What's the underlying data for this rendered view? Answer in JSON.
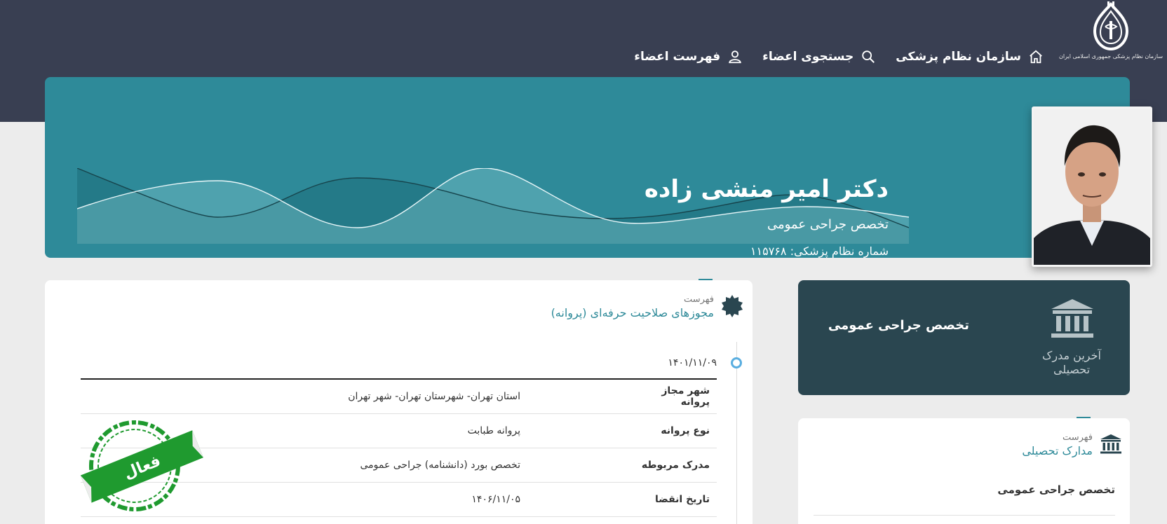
{
  "header": {
    "logo_caption": "سازمان نظام پزشکی جمهوری اسلامی ایران",
    "nav": [
      {
        "label": "سازمان نظام پزشکی",
        "icon": "home-icon"
      },
      {
        "label": "جستجوی اعضاء",
        "icon": "search-icon"
      },
      {
        "label": "فهرست اعضاء",
        "icon": "user-icon"
      }
    ]
  },
  "profile": {
    "name": "دکتر امیر منشی زاده",
    "specialty": "تخصص جراحی عمومی",
    "medical_number": "شماره نظام پزشکی: ۱۱۵۷۶۸"
  },
  "licenses": {
    "small": "فهرست",
    "title": "مجوزهای صلاحیت حرفه‌ای (پروانه)",
    "date": "۱۴۰۱/۱۱/۰۹",
    "rows": [
      {
        "label": "شهر مجاز پروانه",
        "value": "استان تهران- شهرستان تهران- شهر تهران"
      },
      {
        "label": "نوع پروانه",
        "value": "پروانه طبابت"
      },
      {
        "label": "مدرک مربوطه",
        "value": "تخصص بورد (دانشنامه) جراحی عمومی"
      },
      {
        "label": "تاریخ انقضا",
        "value": "۱۴۰۶/۱۱/۰۵"
      }
    ],
    "stamp": "فعال"
  },
  "last_degree": {
    "caption": "آخرین مدرک تحصیلی",
    "title": "تخصص جراحی عمومی"
  },
  "education": {
    "small": "فهرست",
    "title": "مدارک تحصیلی",
    "items": [
      "تخصص جراحی عمومی"
    ]
  },
  "colors": {
    "header_bg": "#393f52",
    "hero_bg": "#2e8a99",
    "dark_card": "#2a4650",
    "accent": "#2e8a99",
    "stamp_green": "#1f9a2f"
  }
}
